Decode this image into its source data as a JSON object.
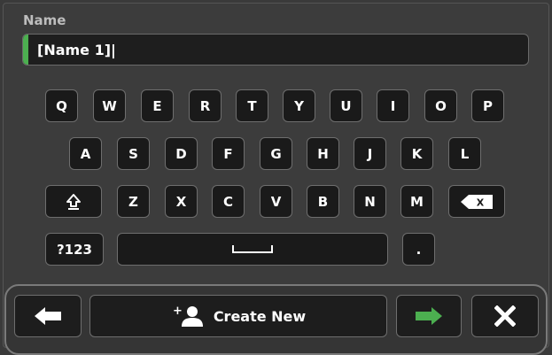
{
  "name_field": {
    "label": "Name",
    "value": "[Name 1]|",
    "accent_color": "#4caf50"
  },
  "keyboard": {
    "row1": [
      "Q",
      "W",
      "E",
      "R",
      "T",
      "Y",
      "U",
      "I",
      "O",
      "P"
    ],
    "row2": [
      "A",
      "S",
      "D",
      "F",
      "G",
      "H",
      "J",
      "K",
      "L"
    ],
    "row3": [
      "Z",
      "X",
      "C",
      "V",
      "B",
      "N",
      "M"
    ],
    "shift_icon": "shift-arrow-icon",
    "backspace_icon": "backspace-icon",
    "backspace_glyph": "X",
    "symbols_label": "?123",
    "space_icon": "space-bar-icon",
    "period_label": "."
  },
  "bottom_bar": {
    "back_icon": "arrow-left-icon",
    "create_icon": "add-person-icon",
    "create_label": "Create New",
    "next_icon": "arrow-right-icon",
    "next_color": "#4caf50",
    "cancel_icon": "close-icon"
  }
}
